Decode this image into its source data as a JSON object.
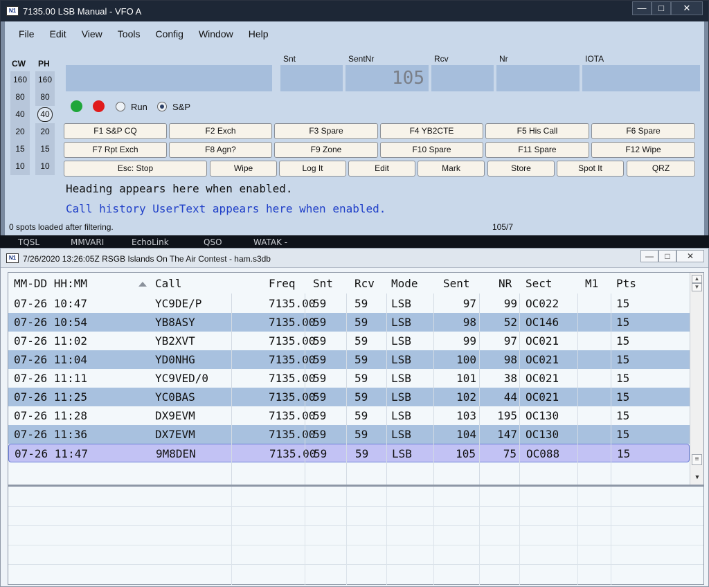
{
  "entry_window": {
    "title": "7135.00 LSB Manual - VFO A",
    "menu": [
      "File",
      "Edit",
      "View",
      "Tools",
      "Config",
      "Window",
      "Help"
    ],
    "bands": {
      "cw_header": "CW",
      "ph_header": "PH",
      "cw": [
        "160",
        "80",
        "40",
        "20",
        "15",
        "10"
      ],
      "ph": [
        "160",
        "80",
        "40",
        "20",
        "15",
        "10"
      ],
      "selected_ph": "40"
    },
    "fields": {
      "call": {
        "label": "",
        "value": ""
      },
      "snt": {
        "label": "Snt",
        "value": ""
      },
      "sentnr": {
        "label": "SentNr",
        "value": "105"
      },
      "rcv": {
        "label": "Rcv",
        "value": ""
      },
      "nr": {
        "label": "Nr",
        "value": ""
      },
      "iota": {
        "label": "IOTA",
        "value": ""
      }
    },
    "mode_radios": {
      "run": "Run",
      "sp": "S&P",
      "selected": "S&P"
    },
    "fkeys_row1": [
      "F1 S&P CQ",
      "F2 Exch",
      "F3 Spare",
      "F4 YB2CTE",
      "F5 His Call",
      "F6 Spare"
    ],
    "fkeys_row2": [
      "F7 Rpt Exch",
      "F8 Agn?",
      "F9 Zone",
      "F10 Spare",
      "F11 Spare",
      "F12 Wipe"
    ],
    "actions": [
      "Esc: Stop",
      "Wipe",
      "Log It",
      "Edit",
      "Mark",
      "Store",
      "Spot It",
      "QRZ"
    ],
    "heading_line": "Heading appears here when enabled.",
    "usertext_line": "Call history UserText appears here when enabled.",
    "status_left": "0 spots loaded after filtering.",
    "status_right": "105/7",
    "colors": {
      "green_led": "#1fa63a",
      "red_led": "#e01b1b",
      "usertext": "#1f3fc8"
    }
  },
  "taskbar_items": [
    "TQSL",
    "MMVARI",
    "EchoLink",
    "QSO",
    "WATAK -"
  ],
  "log_window": {
    "title": "7/26/2020 13:26:05Z  RSGB Islands On The Air Contest - ham.s3db",
    "columns": [
      "MM-DD HH:MM",
      "Call",
      "Freq",
      "Snt",
      "Rcv",
      "Mode",
      "Sent",
      "NR",
      "Sect",
      "M1",
      "Pts"
    ],
    "rows": [
      [
        "07-26 10:47",
        "YC9DE/P",
        "7135.00",
        "59",
        "59",
        "LSB",
        "97",
        "99",
        "OC022",
        "",
        "15"
      ],
      [
        "07-26 10:54",
        "YB8ASY",
        "7135.00",
        "59",
        "59",
        "LSB",
        "98",
        "52",
        "OC146",
        "",
        "15"
      ],
      [
        "07-26 11:02",
        "YB2XVT",
        "7135.00",
        "59",
        "59",
        "LSB",
        "99",
        "97",
        "OC021",
        "",
        "15"
      ],
      [
        "07-26 11:04",
        "YD0NHG",
        "7135.00",
        "59",
        "59",
        "LSB",
        "100",
        "98",
        "OC021",
        "",
        "15"
      ],
      [
        "07-26 11:11",
        "YC9VED/0",
        "7135.00",
        "59",
        "59",
        "LSB",
        "101",
        "38",
        "OC021",
        "",
        "15"
      ],
      [
        "07-26 11:25",
        "YC0BAS",
        "7135.00",
        "59",
        "59",
        "LSB",
        "102",
        "44",
        "OC021",
        "",
        "15"
      ],
      [
        "07-26 11:28",
        "DX9EVM",
        "7135.00",
        "59",
        "59",
        "LSB",
        "103",
        "195",
        "OC130",
        "",
        "15"
      ],
      [
        "07-26 11:36",
        "DX7EVM",
        "7135.00",
        "59",
        "59",
        "LSB",
        "104",
        "147",
        "OC130",
        "",
        "15"
      ],
      [
        "07-26 11:47",
        "9M8DEN",
        "7135.00",
        "59",
        "59",
        "LSB",
        "105",
        "75",
        "OC088",
        "",
        "15"
      ]
    ],
    "selected_row": 8,
    "colors": {
      "alt_row": "#a8c1df",
      "selected_row": "#c2c2f4"
    }
  }
}
